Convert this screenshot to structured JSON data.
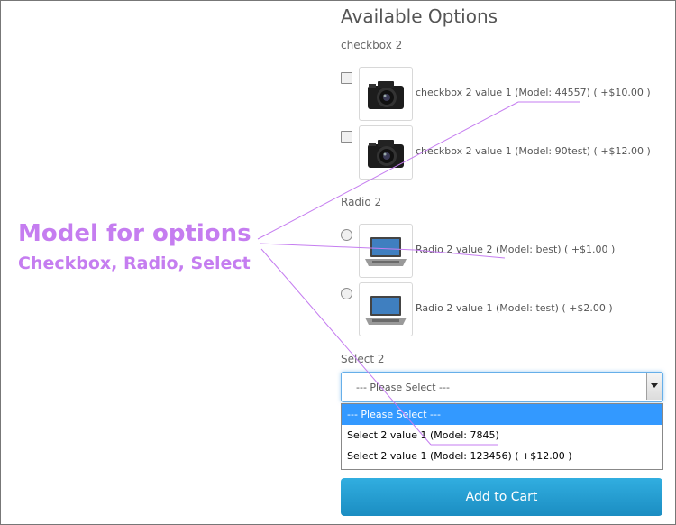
{
  "title": "Available Options",
  "checkbox_group": {
    "label": "checkbox 2",
    "options": [
      {
        "text": "checkbox 2 value 1 (Model: 44557) ( +$10.00 )",
        "image": "camera-icon"
      },
      {
        "text": "checkbox 2 value 1 (Model: 90test) ( +$12.00 )",
        "image": "camera-icon"
      }
    ]
  },
  "radio_group": {
    "label": "Radio 2",
    "options": [
      {
        "text": "Radio 2 value 2 (Model: best) ( +$1.00 )",
        "image": "laptop-icon"
      },
      {
        "text": "Radio 2 value 1 (Model: test) ( +$2.00 )",
        "image": "laptop-icon"
      }
    ]
  },
  "select_group": {
    "label": "Select 2",
    "selected": "--- Please Select ---",
    "options": [
      "--- Please Select ---",
      "Select 2 value 1 (Model: 7845)",
      "Select 2 value 1 (Model: 123456) ( +$12.00 )"
    ]
  },
  "add_to_cart_label": "Add to Cart",
  "annotation": {
    "line1": "Model for options",
    "line2": "Checkbox, Radio, Select",
    "color": "#c57df0"
  },
  "colors": {
    "button": "#1f9bd1",
    "dropdown_highlight": "#3399ff",
    "focus_border": "#66afe9"
  }
}
